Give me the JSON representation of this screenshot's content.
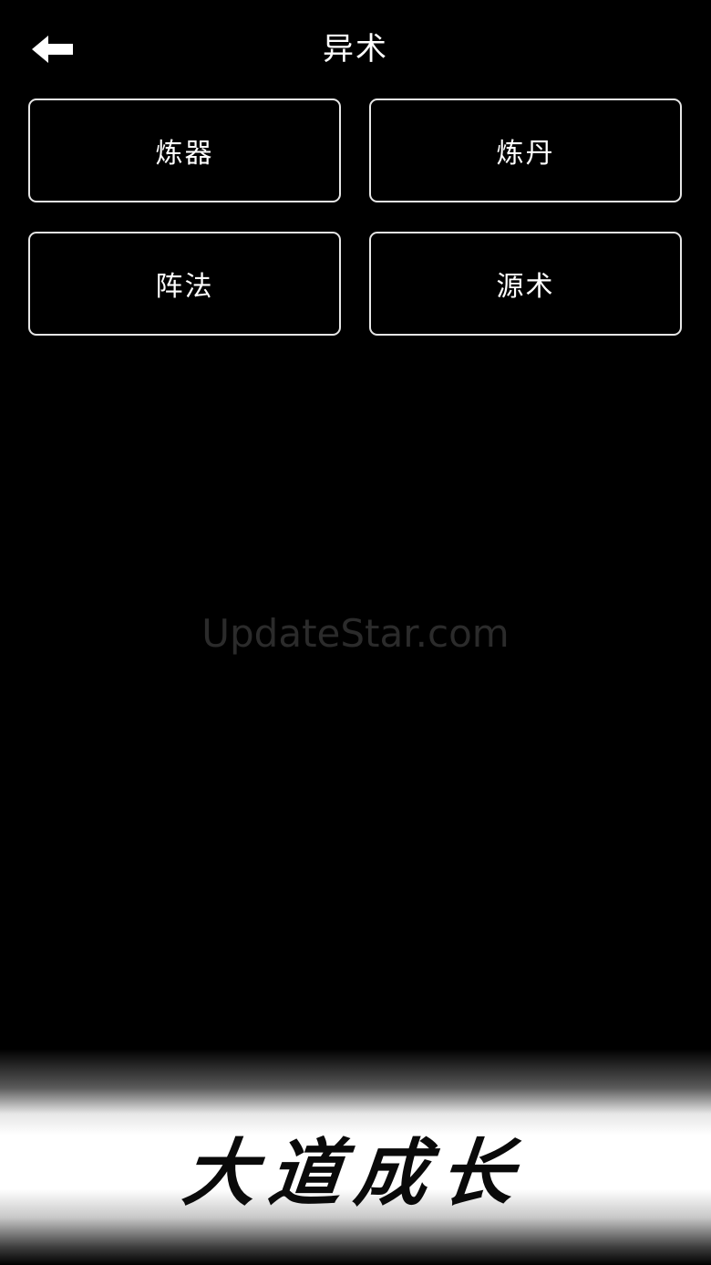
{
  "header": {
    "back_icon": "arrow-left-icon",
    "title": "异术"
  },
  "menu": {
    "items": [
      {
        "label": "炼器"
      },
      {
        "label": "炼丹"
      },
      {
        "label": "阵法"
      },
      {
        "label": "源术"
      }
    ]
  },
  "watermark": "UpdateStar.com",
  "footer": {
    "slogan": "大道成长"
  },
  "colors": {
    "background": "#000000",
    "text": "#ffffff",
    "button_border": "#e6e6e6",
    "glow": "#ffffff"
  }
}
